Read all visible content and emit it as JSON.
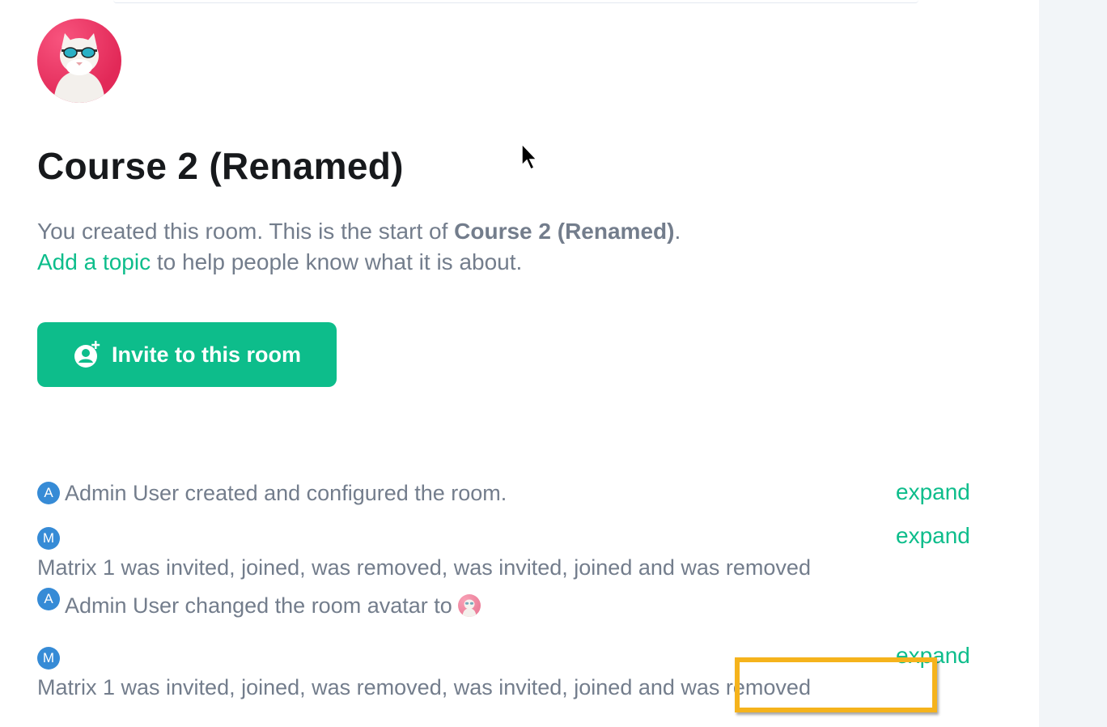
{
  "room": {
    "title": "Course 2 (Renamed)",
    "intro_prefix": "You created this room. This is the start of ",
    "intro_room_name": "Course 2 (Renamed)",
    "intro_suffix": ".",
    "topic_link": "Add a topic",
    "topic_suffix": " to help people know what it is about.",
    "invite_button": "Invite to this room"
  },
  "timeline": [
    {
      "avatar_letter": "A",
      "text": "Admin User created and configured the room.",
      "action": "expand"
    },
    {
      "avatar_letter": "M",
      "text": "Matrix 1 was invited, joined, was removed, was invited, joined and was removed",
      "action": "expand"
    },
    {
      "avatar_letter": "A",
      "text": "Admin User changed the room avatar to "
    },
    {
      "avatar_letter": "M",
      "text": "Matrix 1 was invited, joined, was removed, was invited, joined and was removed",
      "action": "expand"
    }
  ],
  "colors": {
    "accent": "#0dbd8b",
    "highlight": "#f5b31c",
    "avatar_blue": "#368bd6",
    "muted_text": "#737d8c"
  }
}
